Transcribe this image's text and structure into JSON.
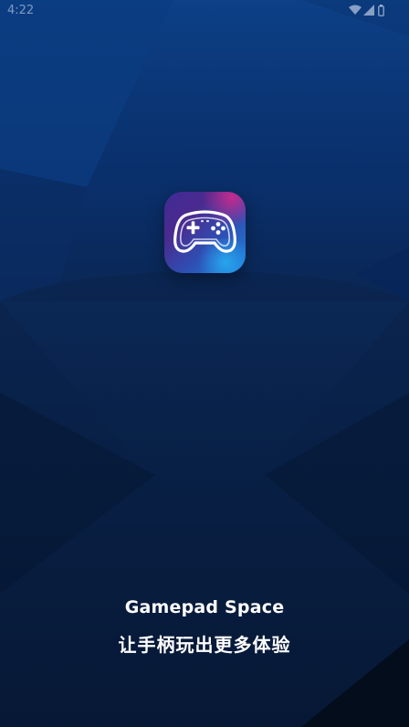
{
  "status_bar": {
    "time": "4:22",
    "icons": [
      "wifi-icon",
      "cellular-signal-icon",
      "battery-icon"
    ]
  },
  "splash": {
    "app_icon": "gamepad-controller-icon",
    "app_name": "Gamepad Space",
    "slogan": "让手柄玩出更多体验"
  },
  "colors": {
    "background_top": "#0b3a7d",
    "background_bottom": "#040914",
    "icon_gradient_start": "#4b2a8e",
    "icon_gradient_end": "#1e86dd",
    "text": "#ffffff"
  }
}
